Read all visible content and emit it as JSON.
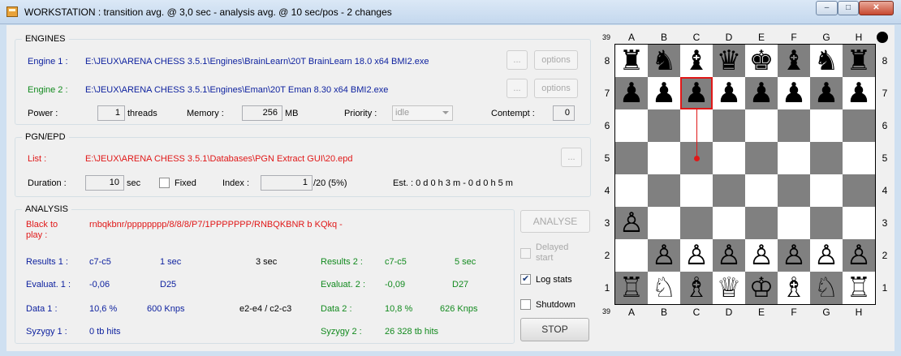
{
  "window": {
    "title": "WORKSTATION : transition avg. @ 3,0 sec - analysis avg. @ 10 sec/pos - 2 changes",
    "controls": {
      "minimize": "–",
      "maximize": "□",
      "close": "✕"
    }
  },
  "engines": {
    "title": "ENGINES",
    "engine1": {
      "label": "Engine 1 :",
      "path": "E:\\JEUX\\ARENA CHESS 3.5.1\\Engines\\BrainLearn\\20T BrainLearn 18.0 x64 BMI2.exe",
      "browse": "...",
      "options": "options"
    },
    "engine2": {
      "label": "Engine 2 :",
      "path": "E:\\JEUX\\ARENA CHESS 3.5.1\\Engines\\Eman\\20T Eman 8.30 x64 BMI2.exe",
      "browse": "...",
      "options": "options"
    },
    "power_label": "Power :",
    "threads_value": "1",
    "threads_unit": "threads",
    "memory_label": "Memory :",
    "memory_value": "256",
    "memory_unit": "MB",
    "priority_label": "Priority :",
    "priority_value": "idle",
    "contempt_label": "Contempt :",
    "contempt_value": "0"
  },
  "pgn": {
    "title": "PGN/EPD",
    "list_label": "List :",
    "list_path": "E:\\JEUX\\ARENA CHESS 3.5.1\\Databases\\PGN Extract GUI\\20.epd",
    "browse": "...",
    "duration_label": "Duration :",
    "duration_value": "10",
    "duration_unit": "sec",
    "fixed_label": "Fixed",
    "index_label": "Index :",
    "index_value": "1",
    "index_suffix": "/20 (5%)",
    "estimate": "Est. : 0 d 0 h 3 m - 0 d 0 h 5 m"
  },
  "analysis": {
    "title": "ANALYSIS",
    "to_play_line1": "Black to",
    "to_play_line2": "play :",
    "fen": "rnbqkbnr/pppppppp/8/8/8/P7/1PPPPPPP/RNBQKBNR b KQkq -",
    "results1_label": "Results 1 :",
    "results1_move": "c7-c5",
    "results1_time": "1 sec",
    "mid_time": "3 sec",
    "results2_label": "Results 2 :",
    "results2_move": "c7-c5",
    "results2_time": "5 sec",
    "eval1_label": "Evaluat. 1 :",
    "eval1_value": "-0,06",
    "eval1_depth": "D25",
    "eval2_label": "Evaluat. 2 :",
    "eval2_value": "-0,09",
    "eval2_depth": "D27",
    "data1_label": "Data 1 :",
    "data1_pct": "10,6 %",
    "data1_nps": "600 Knps",
    "mid_moves": "e2-e4 / c2-c3",
    "data2_label": "Data 2 :",
    "data2_pct": "10,8 %",
    "data2_nps": "626 Knps",
    "syzygy1_label": "Syzygy 1 :",
    "syzygy1_value": "0 tb hits",
    "syzygy2_label": "Syzygy 2 :",
    "syzygy2_value": "26 328 tb hits"
  },
  "controls": {
    "analyse": "ANALYSE",
    "delayed_line1": "Delayed",
    "delayed_line2": "start",
    "log_stats": "Log stats",
    "shutdown": "Shutdown",
    "stop": "STOP"
  },
  "board": {
    "move_number_top": "39",
    "move_number_bottom": "39",
    "files": [
      "A",
      "B",
      "C",
      "D",
      "E",
      "F",
      "G",
      "H"
    ],
    "ranks": [
      "8",
      "7",
      "6",
      "5",
      "4",
      "3",
      "2",
      "1"
    ],
    "rows": [
      [
        "♜",
        "♞",
        "♝",
        "♛",
        "♚",
        "♝",
        "♞",
        "♜"
      ],
      [
        "♟",
        "♟",
        "♟",
        "♟",
        "♟",
        "♟",
        "♟",
        "♟"
      ],
      [
        "",
        "",
        "",
        "",
        "",
        "",
        "",
        ""
      ],
      [
        "",
        "",
        "",
        "",
        "",
        "",
        "",
        ""
      ],
      [
        "",
        "",
        "",
        "",
        "",
        "",
        "",
        ""
      ],
      [
        "♙",
        "",
        "",
        "",
        "",
        "",
        "",
        ""
      ],
      [
        "",
        "♙",
        "♙",
        "♙",
        "♙",
        "♙",
        "♙",
        "♙"
      ],
      [
        "♖",
        "♘",
        "♗",
        "♕",
        "♔",
        "♗",
        "♘",
        "♖"
      ]
    ],
    "highlight_move": "c7-c5",
    "highlight_color": "#e01818"
  }
}
